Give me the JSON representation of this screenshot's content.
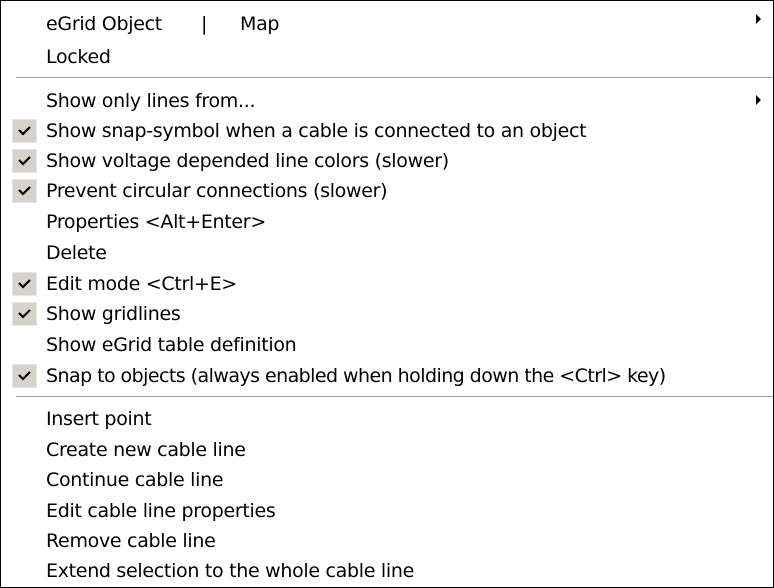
{
  "header": {
    "title": "eGrid Object",
    "divider": "|",
    "submenu": "Map",
    "status": "Locked"
  },
  "menu": {
    "show_only_lines": "Show only lines from...",
    "snap_symbol": "Show snap-symbol when a cable is connected to an object",
    "voltage_colors": "Show voltage depended line colors (slower)",
    "prevent_circular": "Prevent circular connections (slower)",
    "properties": "Properties <Alt+Enter>",
    "delete": "Delete",
    "edit_mode": "Edit mode <Ctrl+E>",
    "show_gridlines": "Show gridlines",
    "table_definition": "Show eGrid table definition",
    "snap_objects": "Snap to objects (always enabled when holding down the <Ctrl> key)",
    "insert_point": "Insert point",
    "create_cable": "Create new cable line",
    "continue_cable": "Continue cable line",
    "edit_cable_props": "Edit cable line properties",
    "remove_cable": "Remove cable line",
    "extend_selection": "Extend selection to the whole cable line"
  },
  "checked": {
    "snap_symbol": true,
    "voltage_colors": true,
    "prevent_circular": true,
    "edit_mode": true,
    "show_gridlines": true,
    "snap_objects": true
  },
  "colors": {
    "check_background": "#d6d3ce",
    "separator": "#a0a0a0"
  }
}
